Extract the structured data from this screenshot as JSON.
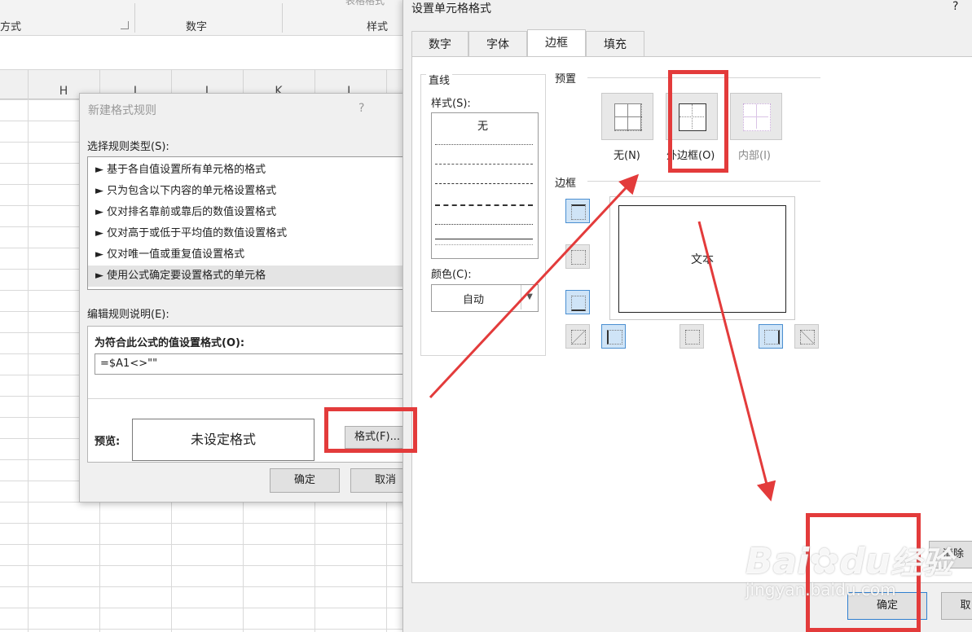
{
  "ribbon": {
    "sections": [
      "方式",
      "数字",
      "样式"
    ],
    "top_label": "表格格式"
  },
  "columns": [
    "H",
    "I",
    "J",
    "K",
    "L"
  ],
  "rule_dialog": {
    "title": "新建格式规则",
    "help": "?",
    "select_label": "选择规则类型(S):",
    "rule_types": [
      "► 基于各自值设置所有单元格的格式",
      "► 只为包含以下内容的单元格设置格式",
      "► 仅对排名靠前或靠后的数值设置格式",
      "► 仅对高于或低于平均值的数值设置格式",
      "► 仅对唯一值或重复值设置格式",
      "► 使用公式确定要设置格式的单元格"
    ],
    "edit_label": "编辑规则说明(E):",
    "formula_label": "为符合此公式的值设置格式(O):",
    "formula_value": "=$A1<>\"\"",
    "preview_label": "预览:",
    "preview_text": "未设定格式",
    "format_button": "格式(F)...",
    "ok_button": "确定",
    "cancel_button": "取消"
  },
  "cell_dialog": {
    "title": "设置单元格格式",
    "help": "?",
    "tabs": [
      "数字",
      "字体",
      "边框",
      "填充"
    ],
    "active_tab": "边框",
    "line_group": "直线",
    "style_label": "样式(S):",
    "style_none": "无",
    "color_label": "颜色(C):",
    "color_value": "自动",
    "presets_label": "预置",
    "preset_none": "无(N)",
    "preset_outline": "外边框(O)",
    "preset_inside": "内部(I)",
    "border_label": "边框",
    "preview_text": "文本",
    "clear_button": "清除",
    "ok_button": "确定",
    "cancel_button": "取"
  },
  "watermark": {
    "brand": "Bai",
    "brand2": "du",
    "product": "经验",
    "url": "jingyan.baidu.com"
  },
  "colors": {
    "annotation": "#e33b3b",
    "selection": "#cfe4f7"
  }
}
